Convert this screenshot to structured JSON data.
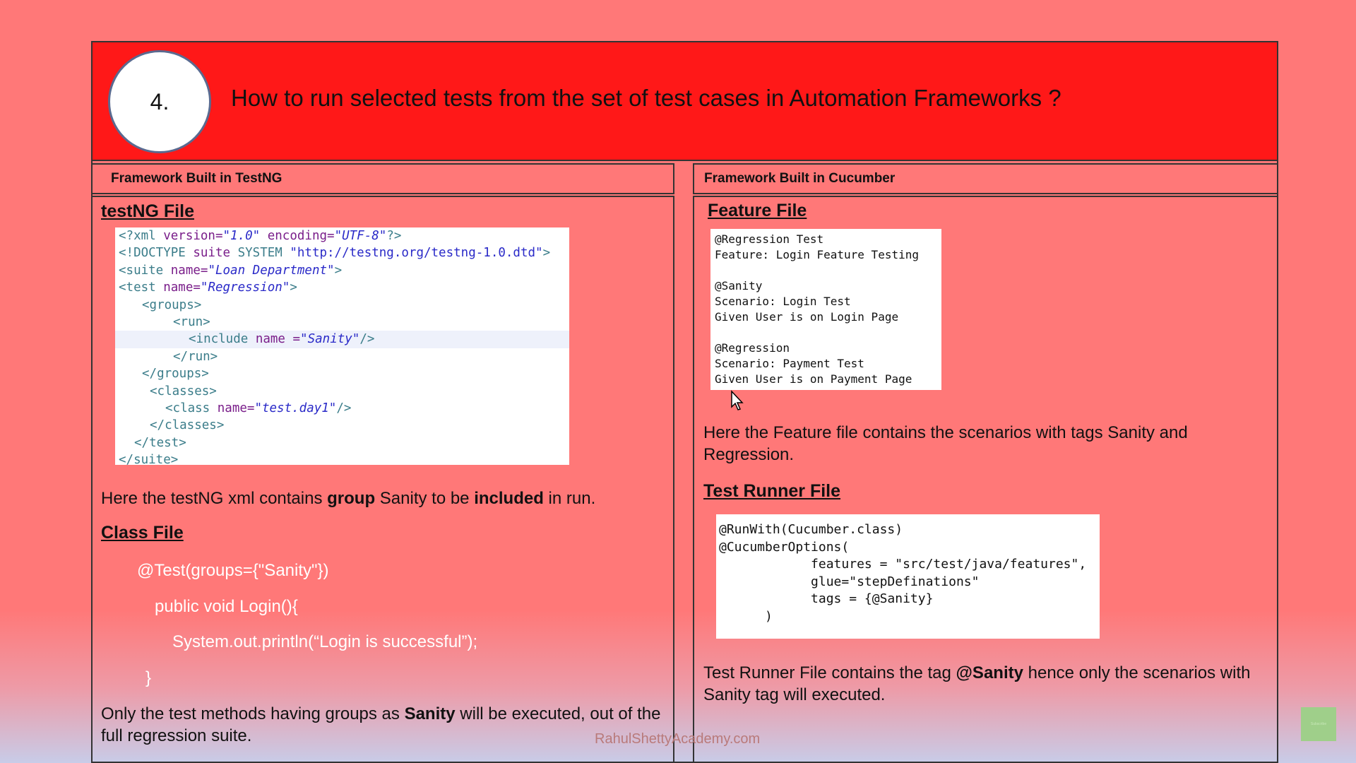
{
  "slide": {
    "number": "4.",
    "title": "How to run selected tests from the set of  test cases in Automation Frameworks ?"
  },
  "left": {
    "header": "Framework Built in TestNG",
    "testng_title": "testNG File",
    "xml_lines": [
      "<?xml version=\"1.0\" encoding=\"UTF-8\"?>",
      "<!DOCTYPE suite SYSTEM \"http://testng.org/testng-1.0.dtd\">",
      "<suite name=\"Loan Department\">",
      "<test name=\"Regression\">",
      "   <groups>",
      "       <run>",
      "         <include name =\"Sanity\"/>",
      "       </run>",
      "   </groups>",
      "    <classes>",
      "      <class name=\"test.day1\"/>",
      "    </classes>",
      "  </test>",
      "</suite>"
    ],
    "desc_pre": "Here the testNG xml contains ",
    "desc_b1": "group",
    "desc_mid": " Sanity to be ",
    "desc_b2": "included",
    "desc_post": " in run.",
    "class_title": "Class File",
    "class_lines": [
      "@Test(groups={\"Sanity\"})",
      "public void Login(){",
      "System.out.println(“Login is successful”);",
      "}"
    ],
    "summary_pre": "Only the test methods having groups as ",
    "summary_b": "Sanity",
    "summary_post": " will be executed, out of the full regression suite."
  },
  "right": {
    "header": "Framework Built in Cucumber",
    "feature_title": "Feature File",
    "feature_lines": [
      "@Regression Test",
      "Feature: Login Feature Testing",
      "",
      "@Sanity",
      "Scenario: Login Test",
      "Given User is on Login Page",
      "",
      "@Regression",
      "Scenario: Payment Test",
      "Given User is on Payment Page"
    ],
    "feature_desc": "Here the Feature file contains the scenarios with tags Sanity and Regression.",
    "runner_title": "Test Runner File",
    "runner_lines": [
      "@RunWith(Cucumber.class)",
      "@CucumberOptions(",
      "            features = \"src/test/java/features\",",
      "            glue=\"stepDefinations\"",
      "            tags = {@Sanity}",
      "      )"
    ],
    "runner_desc_pre": "Test Runner File contains the tag ",
    "runner_desc_b": "@Sanity",
    "runner_desc_post": " hence only the scenarios with Sanity tag will executed."
  },
  "watermark": "RahulShettyAcademy.com",
  "badge": "Subscribe",
  "icons": [
    "mouse-cursor-icon",
    "subscribe-badge-icon"
  ]
}
